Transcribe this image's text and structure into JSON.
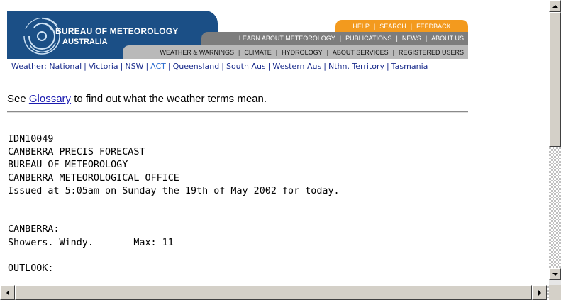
{
  "header": {
    "logo_title": "BUREAU OF METEOROLOGY",
    "logo_subtitle": "AUSTRALIA",
    "top_nav": [
      "HELP",
      "SEARCH",
      "FEEDBACK"
    ],
    "mid_nav": [
      "LEARN ABOUT METEOROLOGY",
      "PUBLICATIONS",
      "NEWS",
      "ABOUT US"
    ],
    "bottom_nav": [
      "WEATHER & WARNINGS",
      "CLIMATE",
      "HYDROLOGY",
      "ABOUT SERVICES",
      "REGISTERED USERS"
    ]
  },
  "state_nav": {
    "prefix": "Weather:",
    "items": [
      "National",
      "Victoria",
      "NSW",
      "ACT",
      "Queensland",
      "South Aus",
      "Western Aus",
      "Nthn. Territory",
      "Tasmania"
    ],
    "active": "ACT"
  },
  "glossary": {
    "before": "See ",
    "link": "Glossary",
    "after": " to find out what the weather terms mean."
  },
  "forecast": {
    "lines": [
      "IDN10049",
      "CANBERRA PRECIS FORECAST",
      "BUREAU OF METEOROLOGY",
      "CANBERRA METEOROLOGICAL OFFICE",
      "Issued at 5:05am on Sunday the 19th of May 2002 for today.",
      "",
      "",
      "CANBERRA:",
      "Showers. Windy.       Max: 11",
      "",
      "OUTLOOK:"
    ]
  },
  "colors": {
    "logo_bg": "#1b4f86",
    "orange_nav": "#f39a1e",
    "grey_nav_dark": "#7d7d7d",
    "grey_nav_light": "#b9b9b9",
    "link_blue": "#1a2c8c"
  }
}
